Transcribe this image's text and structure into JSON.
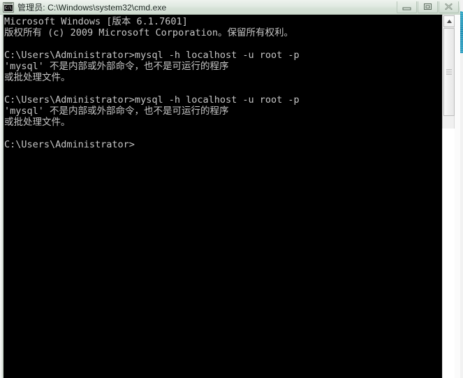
{
  "window": {
    "title": "管理员: C:\\Windows\\system32\\cmd.exe",
    "icon_name": "cmd-icon",
    "icon_glyph": "C:\\",
    "controls": [
      {
        "name": "minimize-button",
        "label": "Minimize"
      },
      {
        "name": "restore-button",
        "label": "Restore"
      },
      {
        "name": "close-button",
        "label": "Close"
      }
    ]
  },
  "console": {
    "text": "Microsoft Windows [版本 6.1.7601]\n版权所有 (c) 2009 Microsoft Corporation。保留所有权利。\n\nC:\\Users\\Administrator>mysql -h localhost -u root -p\n'mysql' 不是内部或外部命令，也不是可运行的程序\n或批处理文件。\n\nC:\\Users\\Administrator>mysql -h localhost -u root -p\n'mysql' 不是内部或外部命令，也不是可运行的程序\n或批处理文件。\n\nC:\\Users\\Administrator>",
    "lines": [
      "Microsoft Windows [版本 6.1.7601]",
      "版权所有 (c) 2009 Microsoft Corporation。保留所有权利。",
      "",
      "C:\\Users\\Administrator>mysql -h localhost -u root -p",
      "'mysql' 不是内部或外部命令，也不是可运行的程序",
      "或批处理文件。",
      "",
      "C:\\Users\\Administrator>mysql -h localhost -u root -p",
      "'mysql' 不是内部或外部命令，也不是可运行的程序",
      "或批处理文件。",
      "",
      "C:\\Users\\Administrator>"
    ],
    "prompt": "C:\\Users\\Administrator>",
    "last_command": "mysql -h localhost -u root -p",
    "error_message": "'mysql' 不是内部或外部命令，也不是可运行的程序 或批处理文件。",
    "os_version": "6.1.7601",
    "copyright_year": "2009",
    "foreground_color": "#c6c6c6",
    "background_color": "#000000"
  },
  "scrollbar": {
    "name": "vertical-scrollbar",
    "up_arrow": "scroll-up-arrow-icon",
    "thumb": "scroll-thumb"
  }
}
